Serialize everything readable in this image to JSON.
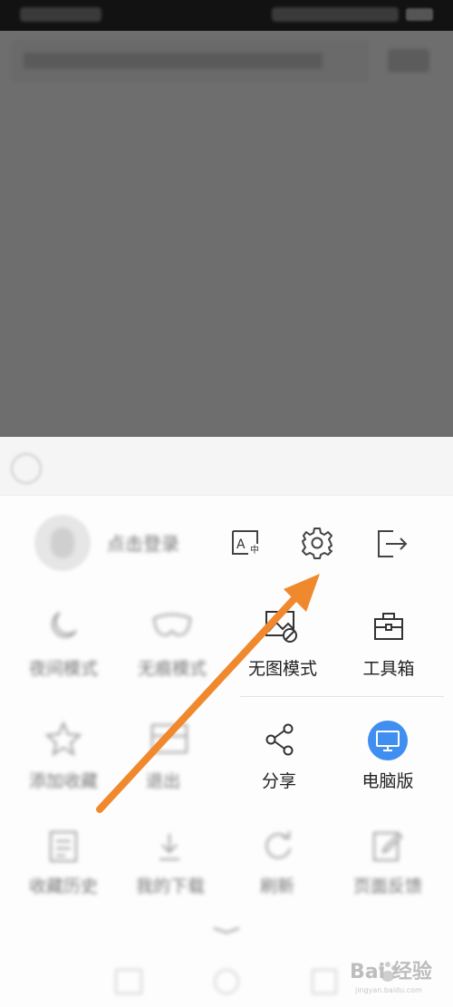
{
  "status_bar": {
    "time": "",
    "icons": ""
  },
  "browser": {
    "url": ""
  },
  "menu": {
    "header_text": "",
    "login_label": "点击登录",
    "top_actions": [
      {
        "name": "translate",
        "icon": "translate-icon"
      },
      {
        "name": "settings",
        "icon": "gear-icon"
      },
      {
        "name": "exit",
        "icon": "exit-icon"
      }
    ],
    "row1": [
      {
        "label": "夜间模式",
        "icon": "moon-icon"
      },
      {
        "label": "无痕模式",
        "icon": "mask-icon"
      },
      {
        "label": "无图模式",
        "icon": "no-image-icon"
      },
      {
        "label": "工具箱",
        "icon": "toolbox-icon"
      }
    ],
    "row2": [
      {
        "label": "添加收藏",
        "icon": "star-icon"
      },
      {
        "label": "退出",
        "icon": "panel-icon"
      },
      {
        "label": "分享",
        "icon": "share-icon"
      },
      {
        "label": "电脑版",
        "icon": "desktop-icon"
      }
    ],
    "row3": [
      {
        "label": "收藏历史",
        "icon": "clipboard-icon"
      },
      {
        "label": "我的下载",
        "icon": "download-icon"
      },
      {
        "label": "刷新",
        "icon": "refresh-icon"
      },
      {
        "label": "页面反馈",
        "icon": "edit-icon"
      }
    ]
  },
  "colors": {
    "accent": "#3f8ef0",
    "arrow": "#f0892e",
    "dim": "#6e6e6e"
  },
  "watermark": {
    "text": "Bai 经验",
    "sub": "jingyan.baidu.com"
  }
}
